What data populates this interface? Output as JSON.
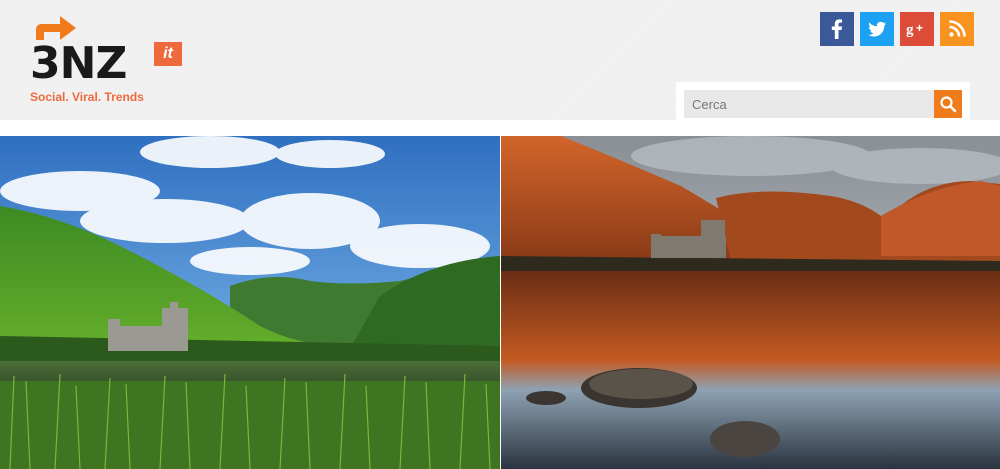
{
  "header": {
    "logo": {
      "mark": "3NZ",
      "tld": "it",
      "tagline": "Social. Viral. Trends"
    },
    "social": [
      {
        "name": "facebook",
        "glyph": "f",
        "color": "#3b5998"
      },
      {
        "name": "twitter",
        "glyph": "twitter-bird",
        "color": "#1da1f2"
      },
      {
        "name": "google-plus",
        "glyph": "g+",
        "color": "#dd4b39"
      },
      {
        "name": "rss",
        "glyph": "rss",
        "color": "#f7931e"
      }
    ],
    "search": {
      "placeholder": "Cerca",
      "button_icon": "search-icon",
      "accent": "#ef7b1a"
    }
  },
  "hero": {
    "images": [
      {
        "name": "castle-green-hills-summer",
        "icon": "landscape-photo"
      },
      {
        "name": "castle-orange-mountains-reflection",
        "icon": "landscape-photo"
      }
    ]
  },
  "colors": {
    "brand_orange": "#ee6a3e",
    "header_bg": "#f0f0f0"
  }
}
